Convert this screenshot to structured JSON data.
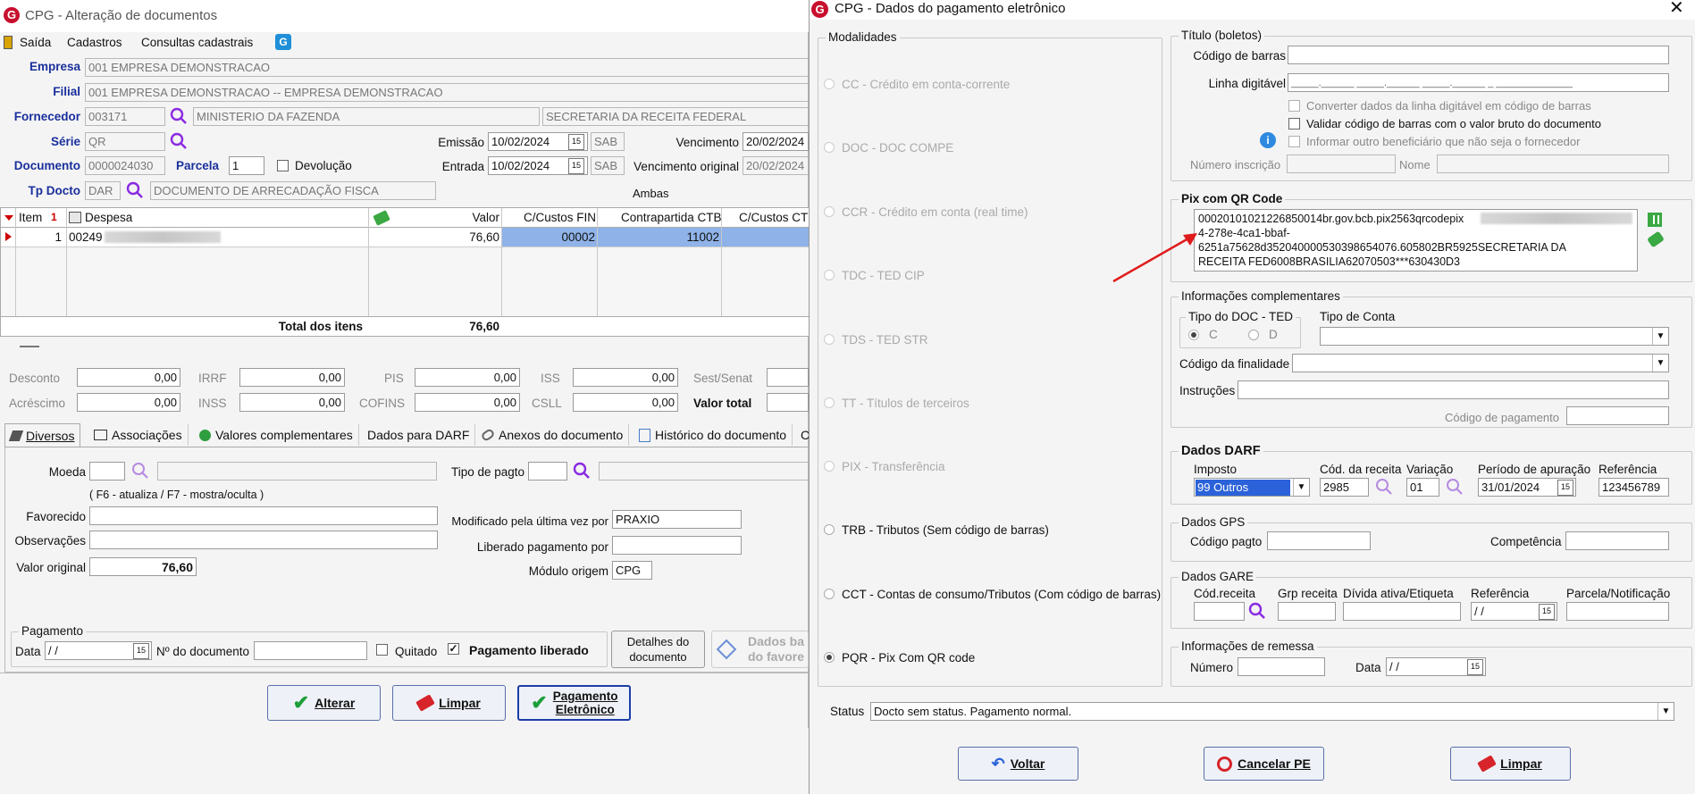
{
  "main_window": {
    "title": "CPG - Alteração de documentos",
    "menu": [
      "Saída",
      "Cadastros",
      "Consultas cadastrais"
    ],
    "empresa_label": "Empresa",
    "empresa_value": "001 EMPRESA DEMONSTRACAO",
    "filial_label": "Filial",
    "filial_value": "001 EMPRESA DEMONSTRACAO -- EMPRESA DEMONSTRACAO",
    "fornecedor_label": "Fornecedor",
    "fornecedor_code": "003171",
    "fornecedor_name": "MINISTERIO DA FAZENDA",
    "fornecedor_name2": "SECRETARIA DA RECEITA FEDERAL",
    "serie_label": "Série",
    "serie_value": "QR",
    "emissao_label": "Emissão",
    "emissao_value": "10/02/2024",
    "emissao_day": "SAB",
    "vencimento_label": "Vencimento",
    "vencimento_value": "20/02/2024",
    "documento_label": "Documento",
    "documento_value": "0000024030",
    "parcela_label": "Parcela",
    "parcela_value": "1",
    "devolucao_label": "Devolução",
    "entrada_label": "Entrada",
    "entrada_value": "10/02/2024",
    "entrada_day": "SAB",
    "venc_original_label": "Vencimento original",
    "venc_original_value": "20/02/2024",
    "tpdocto_label": "Tp Docto",
    "tpdocto_code": "DAR",
    "tpdocto_desc": "DOCUMENTO DE ARRECADAÇÃO FISCA",
    "ambas_label": "Ambas",
    "grid_headers": [
      "Item",
      "Despesa",
      "Valor",
      "C/Custos FIN",
      "Contrapartida CTB",
      "C/Custos CT"
    ],
    "grid_row": {
      "item": "1",
      "despesa": "00249",
      "valor": "76,60",
      "cc_fin": "00002",
      "contrapartida": "11002"
    },
    "total_label": "Total dos itens",
    "total_value": "76,60",
    "desconto_label": "Desconto",
    "desconto_value": "0,00",
    "irrf_label": "IRRF",
    "irrf_value": "0,00",
    "pis_label": "PIS",
    "pis_value": "0,00",
    "iss_label": "ISS",
    "iss_value": "0,00",
    "sest_label": "Sest/Senat",
    "acrescimo_label": "Acréscimo",
    "acrescimo_value": "0,00",
    "inss_label": "INSS",
    "inss_value": "0,00",
    "cofins_label": "COFINS",
    "cofins_value": "0,00",
    "csll_label": "CSLL",
    "csll_value": "0,00",
    "valor_total_label": "Valor total",
    "tabs": [
      "Diversos",
      "Associações",
      "Valores complementares",
      "Dados para DARF",
      "Anexos do documento",
      "Histórico do documento",
      "C"
    ],
    "moeda_label": "Moeda",
    "tipo_pagto_label": "Tipo de pagto",
    "hint": "( F6 - atualiza / F7 - mostra/oculta )",
    "favorecido_label": "Favorecido",
    "modificado_label": "Modificado pela última vez por",
    "modificado_value": "PRAXIO",
    "observacoes_label": "Observações",
    "liberado_label": "Liberado pagamento por",
    "valor_original_label": "Valor original",
    "valor_original_value": "76,60",
    "modulo_label": "Módulo origem",
    "modulo_value": "CPG",
    "pagamento_group": "Pagamento",
    "data_label": "Data",
    "data_value": " / /",
    "ndoc_label": "Nº do documento",
    "quitado_label": "Quitado",
    "pag_liberado_label": "Pagamento liberado",
    "detalhes_btn": "Detalhes do documento",
    "dados_btn": "Dados ba do favore",
    "alterar_btn": "Alterar",
    "limpar_btn": "Limpar",
    "pag_eletronico_btn": "Pagamento Eletrônico"
  },
  "dialog": {
    "title": "CPG - Dados do pagamento eletrônico",
    "modalidades_title": "Modalidades",
    "modalidades": [
      {
        "label": "CC - Crédito em conta-corrente",
        "enabled": false,
        "selected": false
      },
      {
        "label": "DOC - DOC COMPE",
        "enabled": false,
        "selected": false
      },
      {
        "label": "CCR - Crédito em conta (real time)",
        "enabled": false,
        "selected": false
      },
      {
        "label": "TDC - TED CIP",
        "enabled": false,
        "selected": false
      },
      {
        "label": "TDS - TED STR",
        "enabled": false,
        "selected": false
      },
      {
        "label": "TT - Títulos de terceiros",
        "enabled": false,
        "selected": false
      },
      {
        "label": "PIX - Transferência",
        "enabled": false,
        "selected": false
      },
      {
        "label": "TRB - Tributos (Sem código de barras)",
        "enabled": true,
        "selected": false
      },
      {
        "label": "CCT - Contas de consumo/Tributos (Com código de barras)",
        "enabled": true,
        "selected": false
      },
      {
        "label": "PQR - Pix Com QR code",
        "enabled": true,
        "selected": true
      }
    ],
    "titulo_title": "Título (boletos)",
    "codigo_barras_label": "Código de barras",
    "linha_digitavel_label": "Linha digitável",
    "linha_digitavel_mask": "_____.______ _____.______ _____.______ _ ______________",
    "converter_label": "Converter dados da linha digitável em código de barras",
    "validar_label": "Validar código de barras com o valor bruto do documento",
    "informar_label": "Informar outro beneficiário que não seja o fornecedor",
    "numero_inscricao_label": "Número inscrição",
    "nome_label": "Nome",
    "pix_title": "Pix com QR Code",
    "pix_lines": [
      "00020101021226850014br.gov.bcb.pix2563qrcodepix",
      "4-278e-4ca1-bbaf-",
      "6251a75628d352040000530398654076.605802BR5925SECRETARIA DA",
      "RECEITA FED6008BRASILIA62070503***630430D3"
    ],
    "info_title": "Informações complementares",
    "tipo_doc_ted_label": "Tipo do DOC - TED",
    "radio_c": "C",
    "radio_d": "D",
    "tipo_conta_label": "Tipo de Conta",
    "finalidade_label": "Código da finalidade",
    "instrucoes_label": "Instruções",
    "codigo_pagamento_label": "Código de pagamento",
    "darf_title": "Dados DARF",
    "imposto_label": "Imposto",
    "imposto_value": "99 Outros",
    "cod_receita_label": "Cód. da receita",
    "cod_receita_value": "2985",
    "variacao_label": "Variação",
    "variacao_value": "01",
    "periodo_label": "Período de apuração",
    "periodo_value": "31/01/2024",
    "referencia_label": "Referência",
    "referencia_value": "123456789",
    "gps_title": "Dados GPS",
    "codigo_pagto_label": "Código pagto",
    "competencia_label": "Competência",
    "gare_title": "Dados GARE",
    "gare_cod_receita": "Cód.receita",
    "gare_grp": "Grp receita",
    "gare_divida": "Dívida ativa/Etiqueta",
    "gare_referencia": "Referência",
    "gare_ref_value": " / /",
    "gare_parcela": "Parcela/Notificação",
    "remessa_title": "Informações de remessa",
    "numero_label": "Número",
    "data_label": "Data",
    "data_value": " / /",
    "status_label": "Status",
    "status_value": "Docto sem status. Pagamento normal.",
    "voltar_btn": "Voltar",
    "cancelar_btn": "Cancelar PE",
    "limpar_btn": "Limpar"
  }
}
